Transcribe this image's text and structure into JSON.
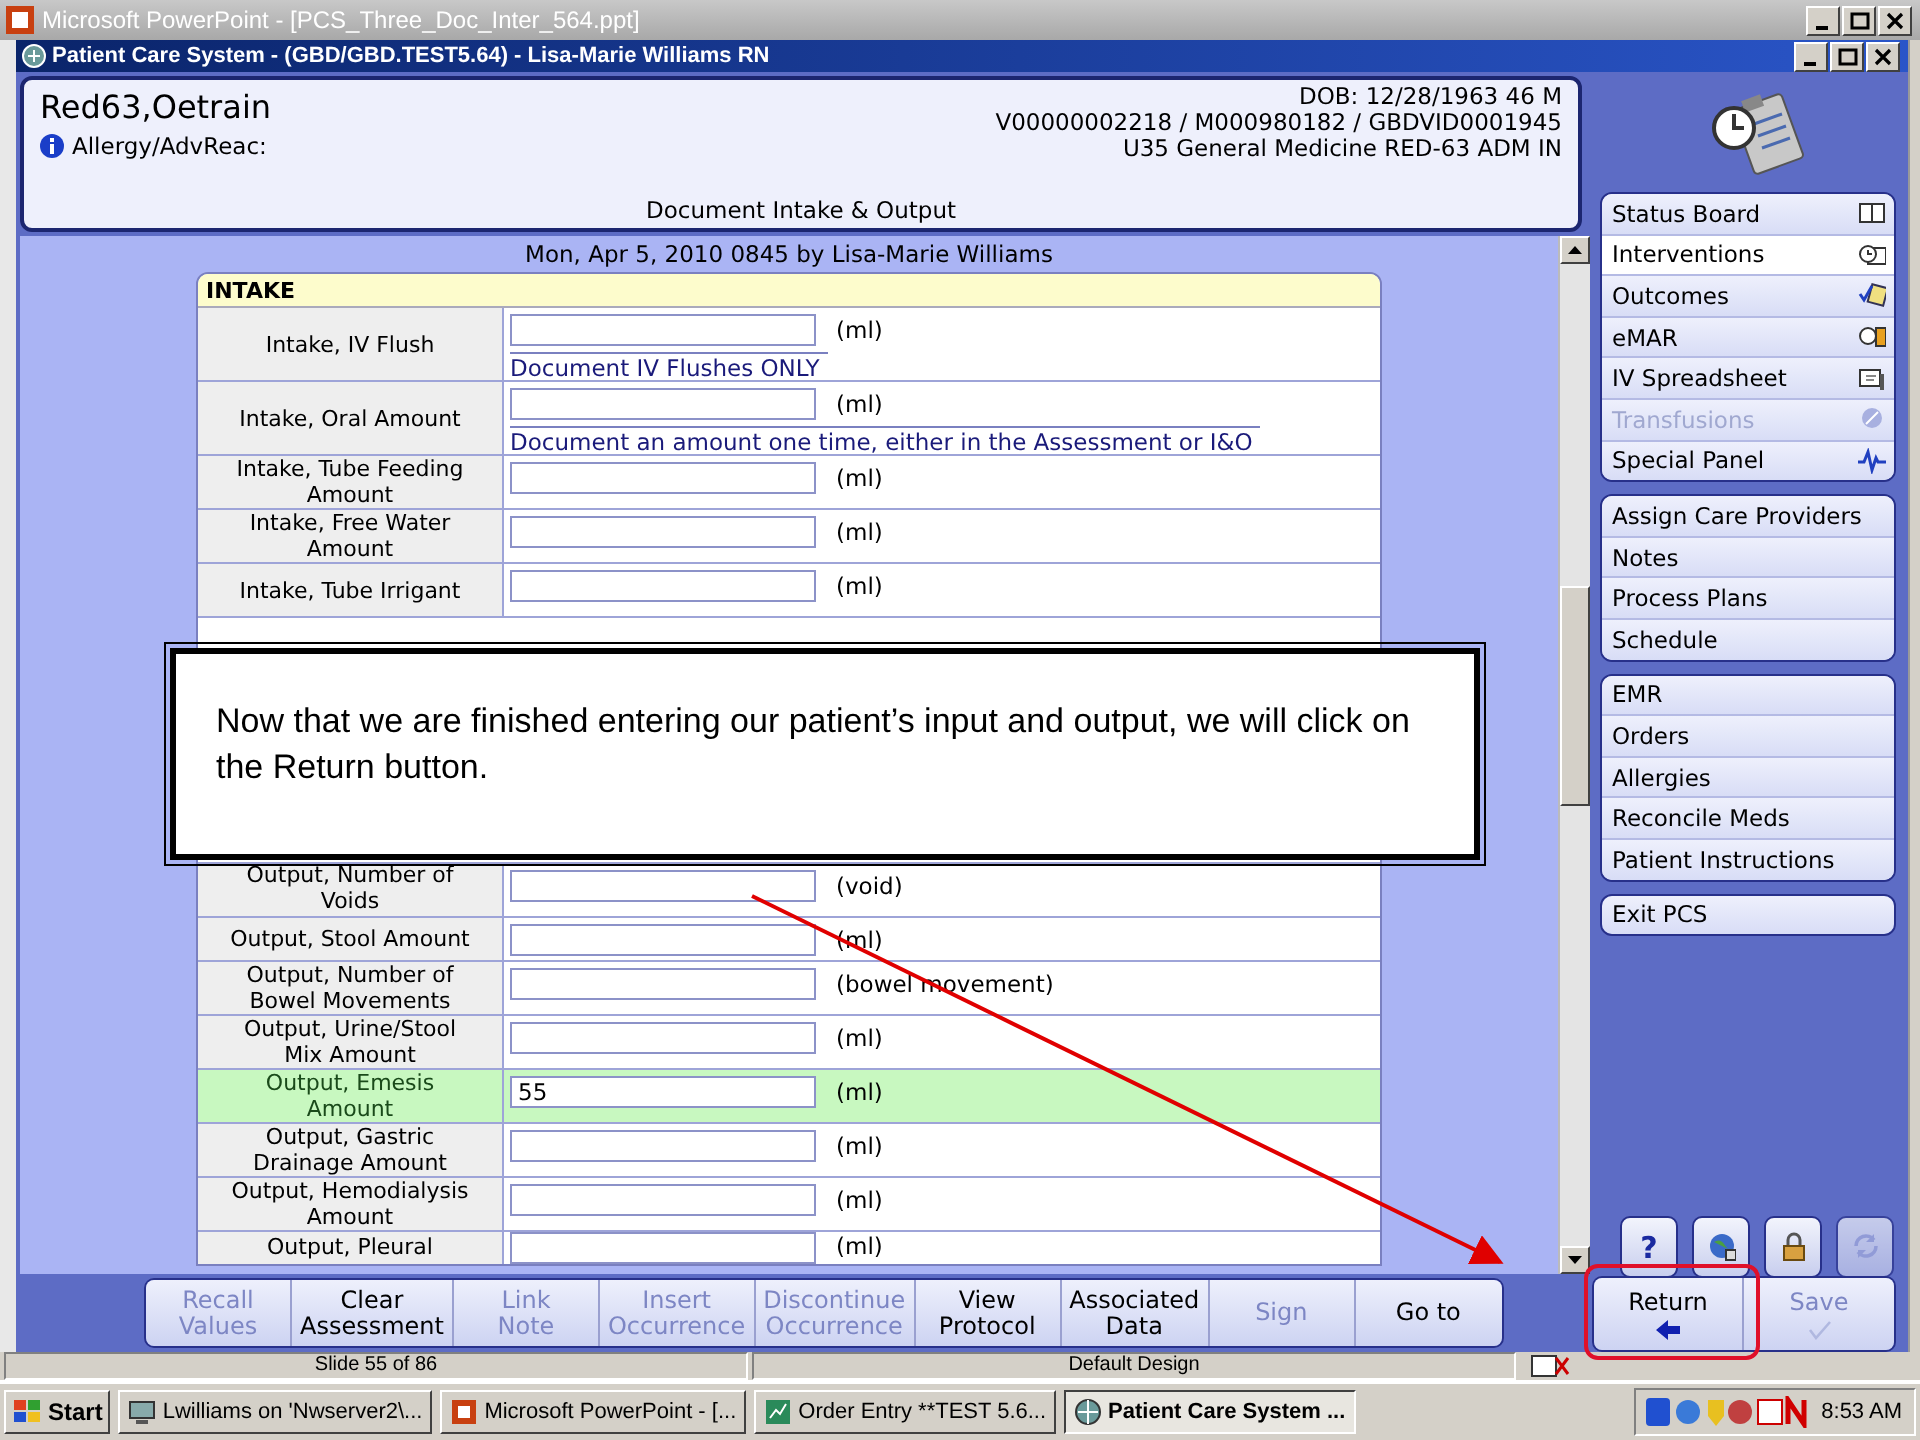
{
  "app_title": "Microsoft PowerPoint - [PCS_Three_Doc_Inter_564.ppt]",
  "window": {
    "title": "Patient Care System - (GBD/GBD.TEST5.64) - Lisa-Marie Williams RN"
  },
  "patient": {
    "name": "Red63,Oetrain",
    "dob": "DOB: 12/28/1963 46 M",
    "ids": "V00000002218 / M000980182 / GBDVID0001945",
    "location": "U35 General Medicine  RED-63  ADM IN",
    "allergy": "Allergy/AdvReac:",
    "document": "Document Intake & Output"
  },
  "entry_line": "Mon,  Apr 5, 2010 0845  by  Lisa-Marie Williams",
  "form": {
    "section": "INTAKE",
    "rows_top": [
      {
        "label": "Intake, IV Flush",
        "unit": "(ml)",
        "note": "Document IV Flushes ONLY",
        "highlighted": false
      },
      {
        "label": "Intake, Oral Amount",
        "unit": "(ml)",
        "note": "Document an amount one time, either in the  Assessment or I&O",
        "highlighted": false
      },
      {
        "label": "Intake, Tube Feeding Amount",
        "unit": "(ml)",
        "highlighted": false
      },
      {
        "label": "Intake, Free Water Amount",
        "unit": "(ml)",
        "highlighted": false
      },
      {
        "label": "Intake, Tube Irrigant",
        "unit": "(ml)",
        "highlighted": false
      }
    ],
    "rows_bottom": [
      {
        "label": "Output, Number of Voids",
        "unit": "(void)",
        "highlighted": false
      },
      {
        "label": "Output, Stool Amount",
        "unit": "(ml)",
        "highlighted": false
      },
      {
        "label": "Output, Number of Bowel Movements",
        "unit": "(bowel movement)",
        "highlighted": false
      },
      {
        "label": "Output, Urine/Stool Mix Amount",
        "unit": "(ml)",
        "highlighted": false
      },
      {
        "label": "Output, Emesis Amount",
        "value": "55",
        "unit": "(ml)",
        "highlighted": true
      },
      {
        "label": "Output, Gastric Drainage Amount",
        "unit": "(ml)",
        "highlighted": false
      },
      {
        "label": "Output, Hemodialysis Amount",
        "unit": "(ml)",
        "highlighted": false
      },
      {
        "label": "Output, Pleural",
        "unit": "(ml)",
        "highlighted": false
      }
    ]
  },
  "sidebar": {
    "groups": [
      [
        {
          "label": "Status Board",
          "selected": false,
          "disabled": false
        },
        {
          "label": "Interventions",
          "selected": true,
          "disabled": false
        },
        {
          "label": "Outcomes",
          "selected": false,
          "disabled": false
        },
        {
          "label": "eMAR",
          "selected": false,
          "disabled": false
        },
        {
          "label": "IV Spreadsheet",
          "selected": false,
          "disabled": false
        },
        {
          "label": "Transfusions",
          "selected": false,
          "disabled": true
        },
        {
          "label": "Special Panel",
          "selected": false,
          "disabled": false
        }
      ],
      [
        {
          "label": "Assign Care Providers",
          "selected": false,
          "disabled": false
        },
        {
          "label": "Notes",
          "selected": false,
          "disabled": false
        },
        {
          "label": "Process Plans",
          "selected": false,
          "disabled": false
        },
        {
          "label": "Schedule",
          "selected": false,
          "disabled": false
        }
      ],
      [
        {
          "label": "EMR",
          "selected": false,
          "disabled": false
        },
        {
          "label": "Orders",
          "selected": false,
          "disabled": false
        },
        {
          "label": "Allergies",
          "selected": false,
          "disabled": false
        },
        {
          "label": "Reconcile Meds",
          "selected": false,
          "disabled": false
        },
        {
          "label": "Patient Instructions",
          "selected": false,
          "disabled": false
        }
      ],
      [
        {
          "label": "Exit PCS",
          "selected": false,
          "disabled": false
        }
      ]
    ]
  },
  "side_tools": [
    {
      "kind": "help",
      "label": "?",
      "disabled": false
    },
    {
      "kind": "globe",
      "disabled": false
    },
    {
      "kind": "lock",
      "disabled": false
    },
    {
      "kind": "refresh",
      "disabled": true
    }
  ],
  "side_actions": [
    {
      "label": "Return",
      "disabled": false,
      "highlighted": true
    },
    {
      "label": "Save",
      "disabled": true,
      "highlighted": false
    }
  ],
  "toolbar": [
    {
      "lines": [
        "Recall",
        "Values"
      ],
      "disabled": true
    },
    {
      "lines": [
        "Clear",
        "Assessment"
      ],
      "disabled": false
    },
    {
      "lines": [
        "Link",
        "Note"
      ],
      "disabled": true
    },
    {
      "lines": [
        "Insert",
        "Occurrence"
      ],
      "disabled": true
    },
    {
      "lines": [
        "Discontinue",
        "Occurrence"
      ],
      "disabled": true
    },
    {
      "lines": [
        "View",
        "Protocol"
      ],
      "disabled": false
    },
    {
      "lines": [
        "Associated",
        "Data"
      ],
      "disabled": false
    },
    {
      "lines": [
        "Sign"
      ],
      "disabled": true
    },
    {
      "lines": [
        "Go to"
      ],
      "disabled": false
    }
  ],
  "callout": {
    "text": "Now that we are finished entering our patient’s input and output, we will click on the Return button."
  },
  "ppt_status": [
    "Slide 55 of 86",
    "Default Design"
  ],
  "taskbar": {
    "start": "Start",
    "tasks": [
      {
        "label": "Lwilliams on 'Nwserver2\\...",
        "selected": false
      },
      {
        "label": "Microsoft PowerPoint - [...",
        "selected": false
      },
      {
        "label": "Order Entry **TEST 5.6...",
        "selected": false
      },
      {
        "label": "Patient Care System ...",
        "selected": true
      }
    ],
    "clock": "8:53 AM"
  }
}
